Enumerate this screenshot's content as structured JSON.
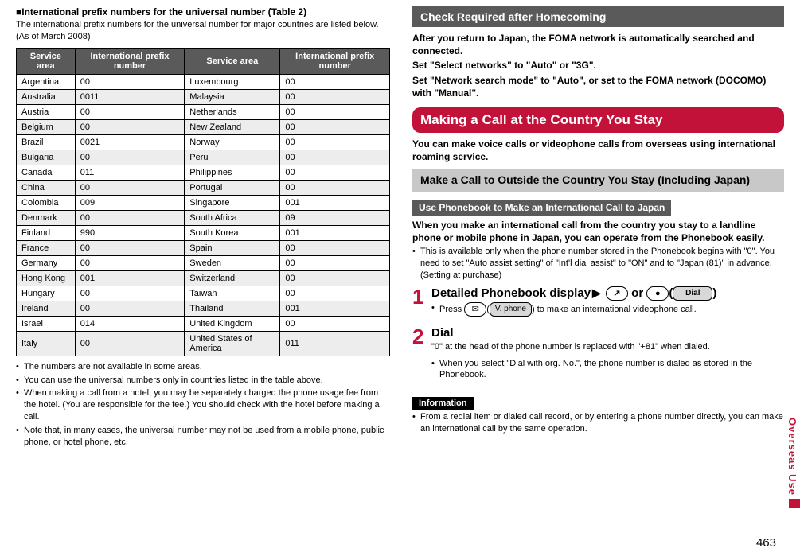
{
  "left": {
    "heading": "■International prefix numbers for the universal number (Table 2)",
    "intro": "The international prefix numbers for the universal number for major countries are listed below. (As of March 2008)",
    "table_headers": {
      "area1": "Service area",
      "num1": "International prefix number",
      "area2": "Service area",
      "num2": "International prefix number"
    },
    "rows": [
      {
        "a1": "Argentina",
        "n1": "00",
        "a2": "Luxembourg",
        "n2": "00"
      },
      {
        "a1": "Australia",
        "n1": "0011",
        "a2": "Malaysia",
        "n2": "00"
      },
      {
        "a1": "Austria",
        "n1": "00",
        "a2": "Netherlands",
        "n2": "00"
      },
      {
        "a1": "Belgium",
        "n1": "00",
        "a2": "New Zealand",
        "n2": "00"
      },
      {
        "a1": "Brazil",
        "n1": "0021",
        "a2": "Norway",
        "n2": "00"
      },
      {
        "a1": "Bulgaria",
        "n1": "00",
        "a2": "Peru",
        "n2": "00"
      },
      {
        "a1": "Canada",
        "n1": "011",
        "a2": "Philippines",
        "n2": "00"
      },
      {
        "a1": "China",
        "n1": "00",
        "a2": "Portugal",
        "n2": "00"
      },
      {
        "a1": "Colombia",
        "n1": "009",
        "a2": "Singapore",
        "n2": "001"
      },
      {
        "a1": "Denmark",
        "n1": "00",
        "a2": "South Africa",
        "n2": "09"
      },
      {
        "a1": "Finland",
        "n1": "990",
        "a2": "South Korea",
        "n2": "001"
      },
      {
        "a1": "France",
        "n1": "00",
        "a2": "Spain",
        "n2": "00"
      },
      {
        "a1": "Germany",
        "n1": "00",
        "a2": "Sweden",
        "n2": "00"
      },
      {
        "a1": "Hong Kong",
        "n1": "001",
        "a2": "Switzerland",
        "n2": "00"
      },
      {
        "a1": "Hungary",
        "n1": "00",
        "a2": "Taiwan",
        "n2": "00"
      },
      {
        "a1": "Ireland",
        "n1": "00",
        "a2": "Thailand",
        "n2": "001"
      },
      {
        "a1": "Israel",
        "n1": "014",
        "a2": "United Kingdom",
        "n2": "00"
      },
      {
        "a1": "Italy",
        "n1": "00",
        "a2": "United States of America",
        "n2": "011"
      }
    ],
    "notes": [
      "The numbers are not available in some areas.",
      "You can use the universal numbers only in countries listed in the table above.",
      "When making a call from a hotel, you may be separately charged the phone usage fee from the hotel. (You are responsible for the fee.) You should check with the hotel before making a call.",
      "Note that, in many cases, the universal number may not be used from a mobile phone, public phone, or hotel phone, etc."
    ]
  },
  "right": {
    "h_gray1": "Check Required after Homecoming",
    "gray1_lines": [
      "After you return to Japan, the FOMA network is automatically searched and connected.",
      "Set \"Select networks\" to \"Auto\" or \"3G\".",
      "Set \"Network search mode\" to \"Auto\", or set to the FOMA network (DOCOMO) with \"Manual\"."
    ],
    "h_red": "Making a Call at the Country You Stay",
    "red_lead": "You can make voice calls or videophone calls from overseas using international roaming service.",
    "h_lightgray": "Make a Call to Outside the Country You Stay (Including Japan)",
    "h_bar": "Use Phonebook to Make an International Call to Japan",
    "bar_lead": "When you make an international call from the country you stay to a landline phone or mobile phone in Japan, you can operate from the Phonebook easily.",
    "bar_note": "This is available only when the phone number stored in the Phonebook begins with \"0\". You need to set \"Auto assist setting\" of \"Int'l dial assist\" to \"ON\" and to \"Japan (81)\" in advance. (Setting at purchase)",
    "step1": {
      "num": "1",
      "title_prefix": "Detailed Phonebook display",
      "or": " or ",
      "dial_label": "Dial",
      "note_prefix": "Press ",
      "note_mid": "(",
      "note_btn": "V. phone",
      "note_suffix": ") to make an international videophone call."
    },
    "step2": {
      "num": "2",
      "title": "Dial",
      "line1": "\"0\" at the head of the phone number is replaced with \"+81\" when dialed.",
      "line2": "When you select \"Dial with org. No.\", the phone number is dialed as stored in the Phonebook."
    },
    "info_label": "Information",
    "info_text": "From a redial item or dialed call record, or by entering a phone number directly, you can make an international call by the same operation."
  },
  "side_label": "Overseas Use",
  "page_number": "463"
}
